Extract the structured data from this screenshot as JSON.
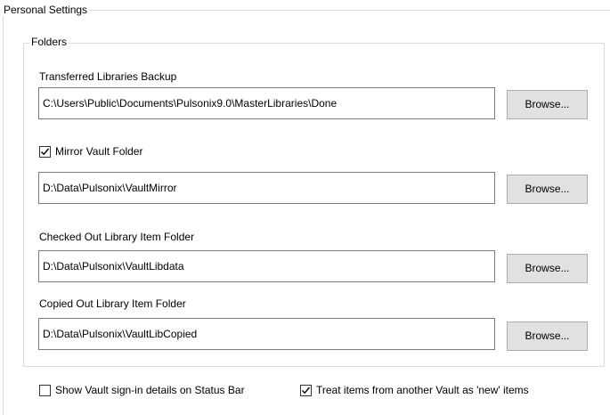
{
  "personal_settings": {
    "legend": "Personal Settings"
  },
  "folders": {
    "legend": "Folders",
    "transferred": {
      "label": "Transferred Libraries Backup",
      "value": "C:\\Users\\Public\\Documents\\Pulsonix9.0\\MasterLibraries\\Done",
      "browse_label": "Browse..."
    },
    "mirror": {
      "label": "Mirror Vault Folder",
      "checked": true,
      "value": "D:\\Data\\Pulsonix\\VaultMirror",
      "browse_label": "Browse..."
    },
    "checked_out": {
      "label": "Checked Out Library Item Folder",
      "value": "D:\\Data\\Pulsonix\\VaultLibdata",
      "browse_label": "Browse..."
    },
    "copied_out": {
      "label": "Copied Out Library Item Folder",
      "value": "D:\\Data\\Pulsonix\\VaultLibCopied",
      "browse_label": "Browse..."
    }
  },
  "options": {
    "show_signin": {
      "label": "Show Vault sign-in details on Status Bar",
      "checked": false
    },
    "treat_new": {
      "label": "Treat items from another Vault as 'new' items",
      "checked": true
    }
  }
}
